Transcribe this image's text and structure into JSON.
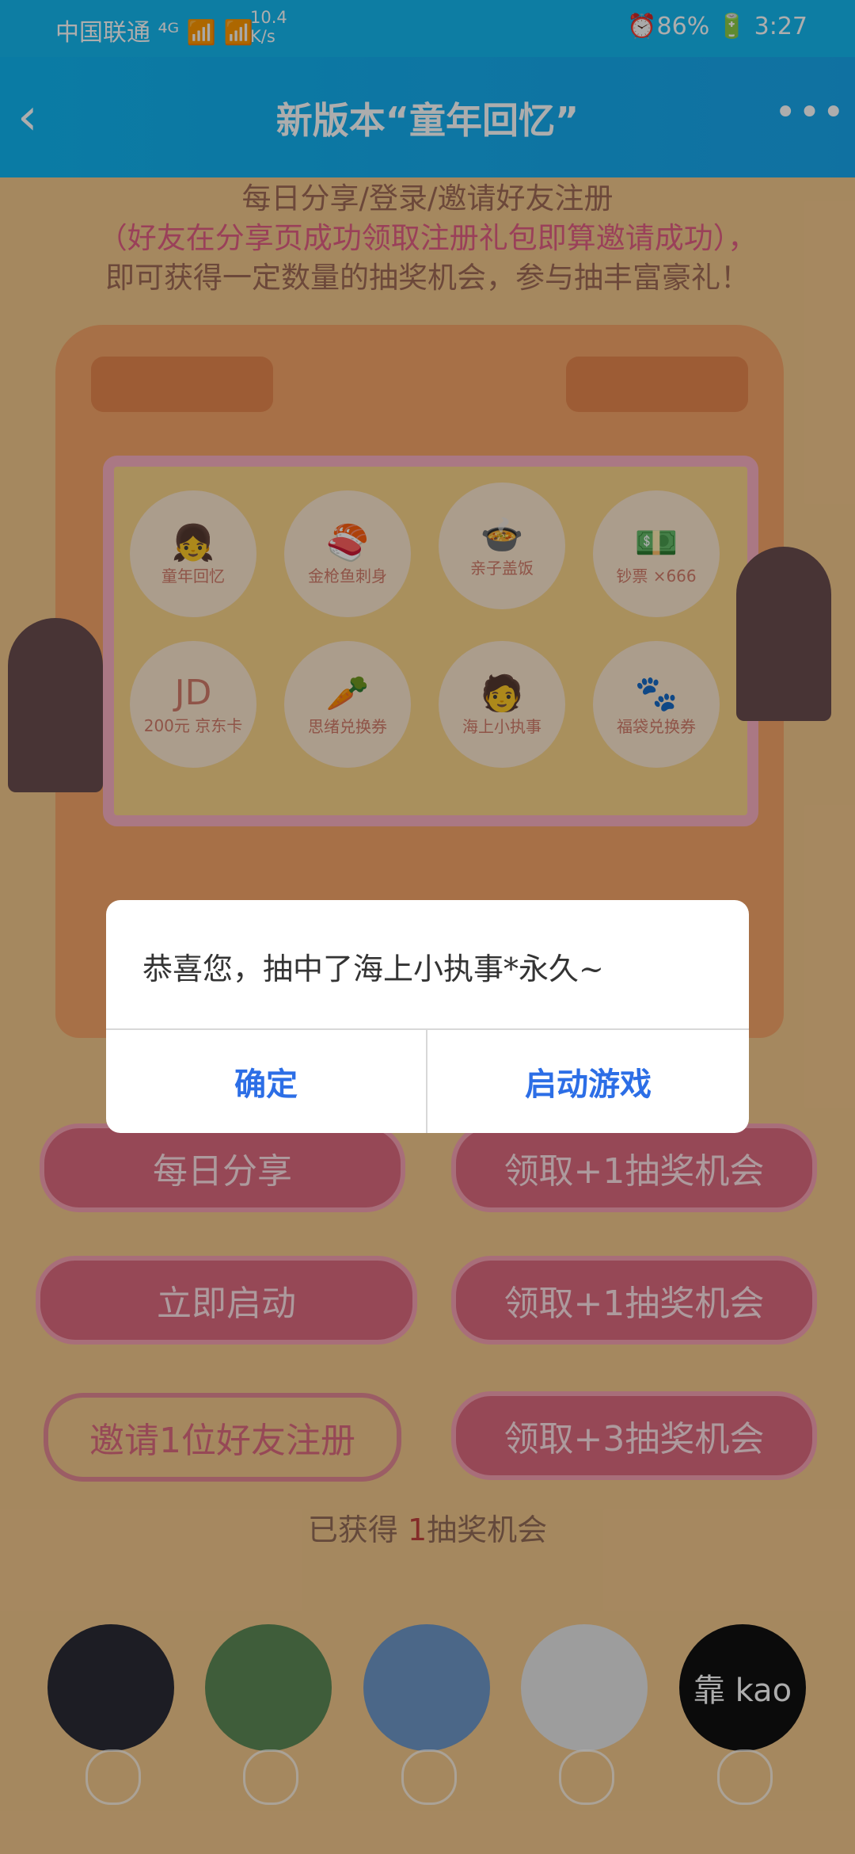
{
  "statusbar": {
    "carrier": "中国联通 ⁴ᴳ 📶 📶",
    "speed_value": "10.4",
    "speed_unit": "K/s",
    "right": "⏰86% 🔋 3:27"
  },
  "nav": {
    "title": "新版本“童年回忆”"
  },
  "intro": {
    "line1": "每日分享/登录/邀请好友注册",
    "line2": "（好友在分享页成功领取注册礼包即算邀请成功），",
    "line3": "即可获得一定数量的抽奖机会，参与抽丰富豪礼！"
  },
  "prizes": [
    {
      "label": "童年回忆",
      "icon": "👧"
    },
    {
      "label": "金枪鱼刺身",
      "icon": "🍣"
    },
    {
      "label": "亲子盖饭",
      "icon": "🍲"
    },
    {
      "label": "钞票 ×666",
      "icon": "💵"
    },
    {
      "label": "200元 京东卡",
      "icon": "JD"
    },
    {
      "label": "思绪兑换券",
      "icon": "🥕"
    },
    {
      "label": "海上小执事",
      "icon": "🧑"
    },
    {
      "label": "福袋兑换券",
      "icon": "🐾"
    }
  ],
  "buttons": {
    "daily_share": "每日分享",
    "launch_now": "立即启动",
    "invite": "邀请1位好友注册",
    "claim1a": "领取+1抽奖机会",
    "claim1b": "领取+1抽奖机会",
    "claim3": "领取+3抽奖机会"
  },
  "status": {
    "prefix": "已获得",
    "count": "1",
    "suffix": "抽奖机会"
  },
  "avatars": [
    {
      "label": "",
      "color": "#2b2c35"
    },
    {
      "label": "",
      "color": "#5e8a56"
    },
    {
      "label": "",
      "color": "#6f99c9"
    },
    {
      "label": "",
      "color": "#e7e7e7"
    },
    {
      "label": "靠 kao",
      "color": "#111"
    }
  ],
  "dialog": {
    "message": "恭喜您，抽中了海上小执事*永久~",
    "ok": "确定",
    "start_game": "启动游戏"
  }
}
